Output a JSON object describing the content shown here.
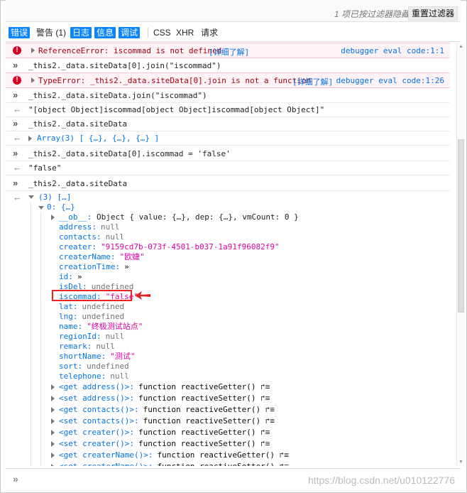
{
  "toolbar": {
    "hidden_note": "1 项已按过滤器隐藏",
    "reset_label": "重置过滤器"
  },
  "filters": [
    {
      "label": "错误",
      "active": true
    },
    {
      "label": "警告 (1)",
      "active": false
    },
    {
      "label": "日志",
      "active": true
    },
    {
      "label": "信息",
      "active": true
    },
    {
      "label": "调试",
      "active": true
    },
    {
      "label": "CSS",
      "active": false
    },
    {
      "label": "XHR",
      "active": false
    },
    {
      "label": "请求",
      "active": false
    }
  ],
  "log": {
    "err1_text": "ReferenceError: iscommad is not defined",
    "err1_link": "[详细了解]",
    "err1_loc": "debugger eval code:1:1",
    "in1": "_this2._data.siteData[0].join(\"iscommad\")",
    "err2_text": "TypeError: _this2._data.siteData[0].join is not a function",
    "err2_link": "[详细了解]",
    "err2_loc": "debugger eval code:1:26",
    "in2": "_this2._data.siteData.join(\"iscommad\")",
    "out2": "\"[object Object]iscommad[object Object]iscommad[object Object]\"",
    "in3": "_this2._data.siteData",
    "out3": "Array(3) [ {…}, {…}, {…} ]",
    "in4": "_this2._data.siteData[0].iscommad = 'false'",
    "out4": "\"false\"",
    "in5": "_this2._data.siteData",
    "out5": "(3) […]"
  },
  "tree": {
    "item0": "0: {…}",
    "ob_key": "__ob__:",
    "ob_val": "Object { value: {…}, dep: {…}, vmCount: 0 }",
    "props": [
      {
        "k": "address:",
        "v": "null",
        "t": "null"
      },
      {
        "k": "contacts:",
        "v": "null",
        "t": "null"
      },
      {
        "k": "creater:",
        "v": "\"9159cd7b-073f-4501-b037-1a91f96082f9\"",
        "t": "str"
      },
      {
        "k": "createrName:",
        "v": "\"欧婕\"",
        "t": "str"
      },
      {
        "k": "creationTime:",
        "v": "»",
        "t": "fn"
      },
      {
        "k": "id:",
        "v": "»",
        "t": "fn"
      },
      {
        "k": "isDel:",
        "v": "undefined",
        "t": "null"
      },
      {
        "k": "iscommad:",
        "v": "\"false\"",
        "t": "str"
      },
      {
        "k": "lat:",
        "v": "undefined",
        "t": "null"
      },
      {
        "k": "lng:",
        "v": "undefined",
        "t": "null"
      },
      {
        "k": "name:",
        "v": "\"终极测试站点\"",
        "t": "str"
      },
      {
        "k": "regionId:",
        "v": "null",
        "t": "null"
      },
      {
        "k": "remark:",
        "v": "null",
        "t": "null"
      },
      {
        "k": "shortName:",
        "v": "\"测试\"",
        "t": "str"
      },
      {
        "k": "sort:",
        "v": "undefined",
        "t": "null"
      },
      {
        "k": "telephone:",
        "v": "null",
        "t": "null"
      }
    ],
    "accessors": [
      {
        "k": "<get address()>:",
        "v": "function reactiveGetter()"
      },
      {
        "k": "<set address()>:",
        "v": "function reactiveSetter()"
      },
      {
        "k": "<get contacts()>:",
        "v": "function reactiveGetter()"
      },
      {
        "k": "<set contacts()>:",
        "v": "function reactiveSetter()"
      },
      {
        "k": "<get creater()>:",
        "v": "function reactiveGetter()"
      },
      {
        "k": "<set creater()>:",
        "v": "function reactiveSetter()"
      },
      {
        "k": "<get createrName()>:",
        "v": "function reactiveGetter()"
      },
      {
        "k": "<set createrName()>:",
        "v": "function reactiveSetter()"
      }
    ]
  },
  "input": {
    "prompt": "»",
    "watermark": "https://blog.csdn.net/u010122776"
  },
  "colors": {
    "accent": "#0a84ff",
    "error_bg": "#fdf2f5",
    "error_text": "#a4000f",
    "highlight": "#e22222"
  }
}
